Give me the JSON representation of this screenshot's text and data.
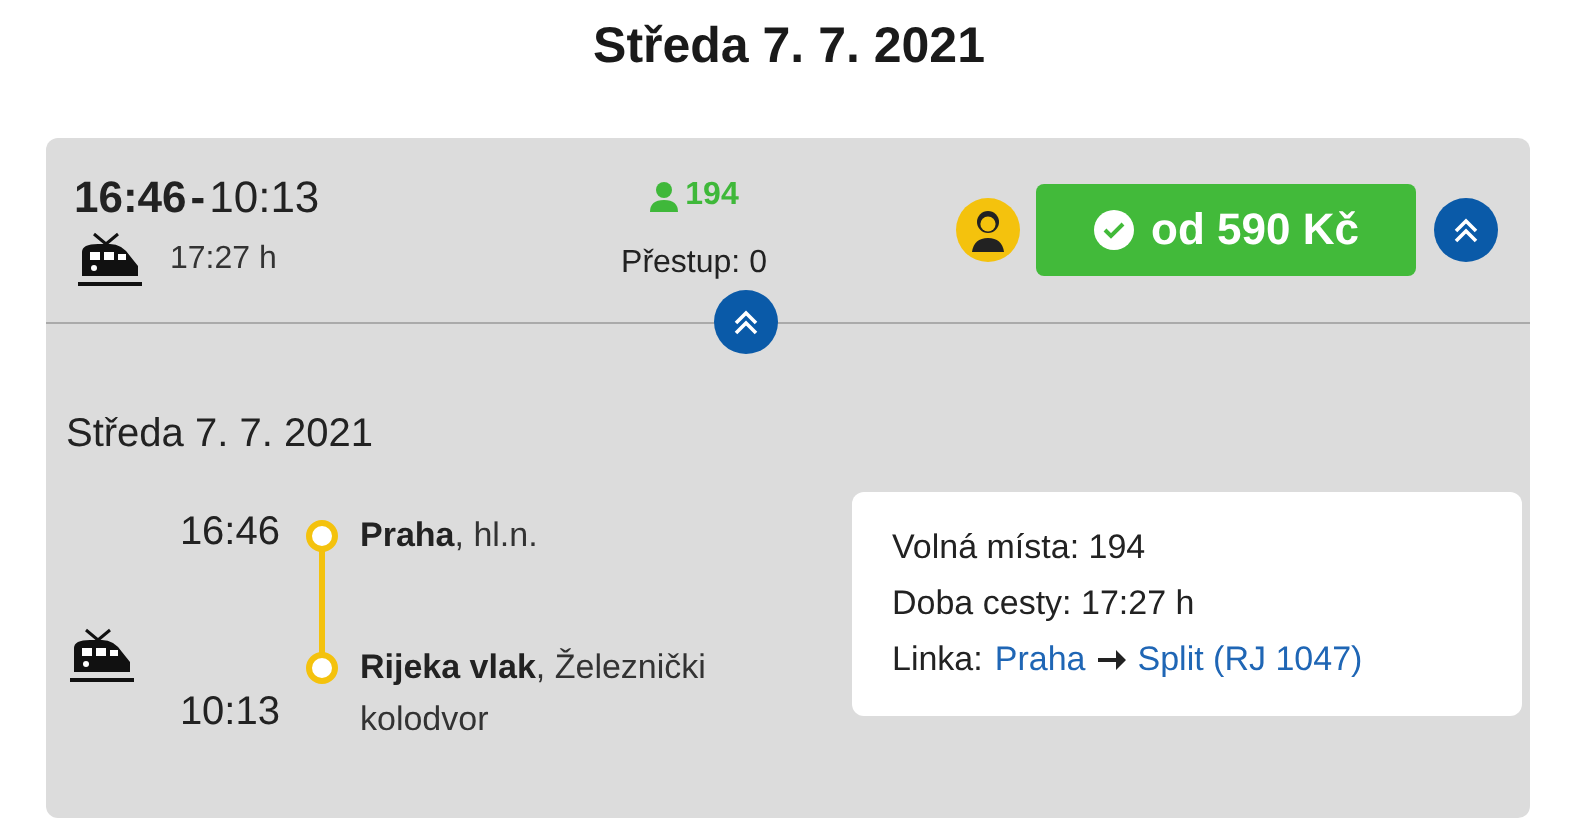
{
  "page_title": "Středa 7. 7. 2021",
  "connection": {
    "departure": "16:46",
    "separator": "-",
    "arrival": "10:13",
    "duration": "17:27 h",
    "seats": "194",
    "transfers": "Přestup: 0",
    "price": "od 590 Kč",
    "expanded": true,
    "detail": {
      "date": "Středa 7. 7. 2021",
      "stops": [
        {
          "time": "16:46",
          "station": "**Praha**, hl.n."
        },
        {
          "time": "10:13",
          "station": "**Rijeka vlak**, Železnički kolodvor"
        }
      ],
      "info": {
        "seats_line": "Volná místa: 194",
        "duration_line": "Doba cesty: 17:27 h",
        "line_label": "Linka:",
        "line_from": "Praha",
        "line_to": "Split (RJ 1047)"
      }
    }
  }
}
